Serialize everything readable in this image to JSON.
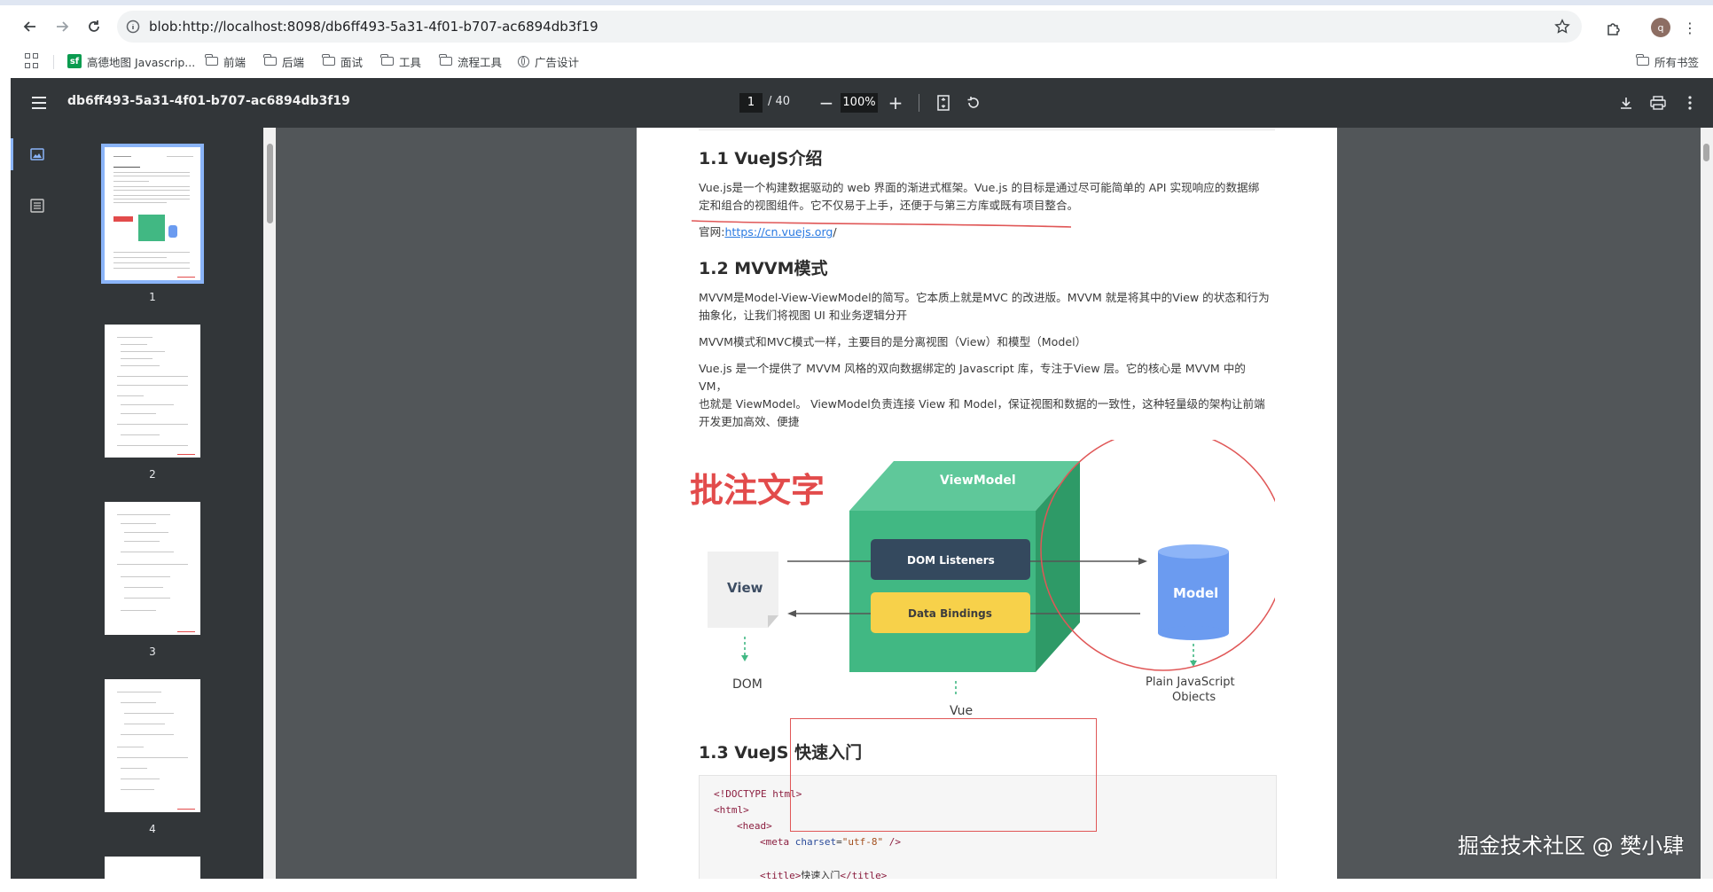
{
  "browser": {
    "url": "blob:http://localhost:8098/db6ff493-5a31-4f01-b707-ac6894db3f19",
    "profile_initial": "q",
    "bookmarks": [
      {
        "label": "高德地图 Javascrip...",
        "icon": "sf-icon"
      },
      {
        "label": "前端",
        "icon": "folder-icon"
      },
      {
        "label": "后端",
        "icon": "folder-icon"
      },
      {
        "label": "面试",
        "icon": "folder-icon"
      },
      {
        "label": "工具",
        "icon": "folder-icon"
      },
      {
        "label": "流程工具",
        "icon": "folder-icon"
      },
      {
        "label": "广告设计",
        "icon": "globe-icon"
      }
    ],
    "all_bookmarks_label": "所有书签"
  },
  "pdf": {
    "title": "db6ff493-5a31-4f01-b707-ac6894db3f19",
    "page_current": "1",
    "page_total": "/ 40",
    "zoom": "100%",
    "thumbnails": [
      "1",
      "2",
      "3",
      "4"
    ]
  },
  "doc": {
    "h1_1": "1.1 VueJS介绍",
    "p1_line1": "Vue.js是一个构建数据驱动的 web 界面的渐进式框架。Vue.js 的目标是通过尽可能简单的 API 实现响应的数据绑",
    "p1_line2": "定和组合的视图组件。它不仅易于上手，还便于与第三方库或既有项目整合。",
    "site_label": "官网:",
    "site_link": "https://cn.vuejs.org",
    "site_suffix": "/",
    "h1_2": "1.2 MVVM模式",
    "p2_line1": "MVVM是Model-View-ViewModel的简写。它本质上就是MVC 的改进版。MVVM 就是将其中的View 的状态和行为",
    "p2_line2": "抽象化，让我们将视图 UI 和业务逻辑分开",
    "p3": "MVVM模式和MVC模式一样，主要目的是分离视图（View）和模型（Model）",
    "p4_line1": "Vue.js 是一个提供了 MVVM 风格的双向数据绑定的 Javascript 库，专注于View 层。它的核心是 MVVM 中的 VM，",
    "p4_line2": "也就是 ViewModel。 ViewModel负责连接 View 和 Model，保证视图和数据的一致性，这种轻量级的架构让前端",
    "p4_line3": "开发更加高效、便捷",
    "h1_3": "1.3 VueJS 快速入门",
    "diagram": {
      "annotation": "批注文字",
      "viewmodel": "ViewModel",
      "dom_listeners": "DOM Listeners",
      "data_bindings": "Data Bindings",
      "view": "View",
      "model": "Model",
      "dom": "DOM",
      "vue": "Vue",
      "plain_js_1": "Plain JavaScript",
      "plain_js_2": "Objects"
    },
    "code": {
      "l1": "<!DOCTYPE html>",
      "l2": "<html>",
      "l3": "<head>",
      "l4_open": "<meta ",
      "l4_attr": "charset",
      "l4_eq": "=",
      "l4_val": "\"utf-8\"",
      "l4_close": " />",
      "l5_open": "<title>",
      "l5_text": "快速入门",
      "l5_close": "</title>"
    }
  },
  "watermark": "掘金技术社区 @ 樊小肆",
  "colors": {
    "toolbar": "#323639",
    "page_bg": "#525659",
    "annotation_red": "#e05757",
    "vue_green": "#41b883",
    "model_blue": "#6b9bf0"
  }
}
